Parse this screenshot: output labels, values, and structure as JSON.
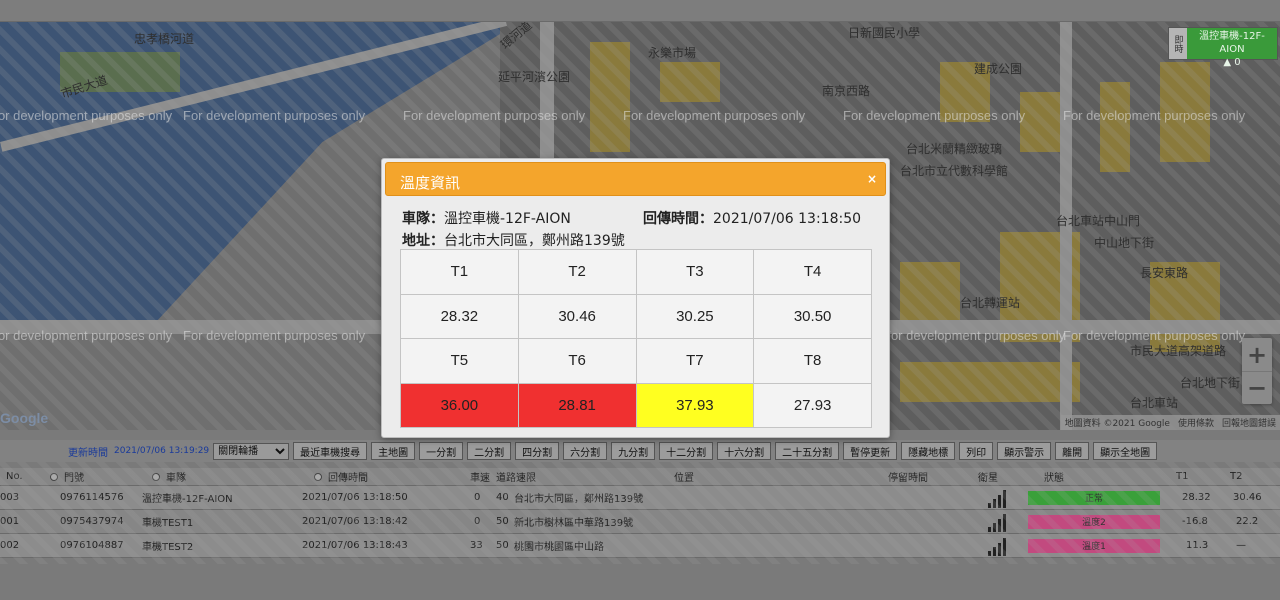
{
  "map": {
    "dev_watermark": "For development purposes only",
    "labels": [
      "忠孝橋河道",
      "市民大道",
      "環河道",
      "延平河濱公園",
      "永樂市場",
      "日新國民小學",
      "建成公園",
      "南京西路",
      "台北米蘭精緻玻璃",
      "台北市立代數科學館",
      "台北車站中山門",
      "中山地下街",
      "台北轉運站",
      "市民大道高架道路",
      "台北地下街",
      "台北車站",
      "長安東路"
    ],
    "attribution": [
      "地圖資料 ©2021 Google",
      "使用條款",
      "回報地圖錯誤"
    ],
    "zoom_in": "+",
    "zoom_out": "−",
    "vehicle_marker": {
      "side": "即時",
      "name": "溫控車機-12F-AION",
      "speed": "0"
    }
  },
  "toolbar": {
    "update_label": "更新時間",
    "update_time": "2021/07/06 13:19:29",
    "rotate_select": "關閉輪播",
    "buttons": [
      "最近車機搜尋",
      "主地圖",
      "一分割",
      "二分割",
      "四分割",
      "六分割",
      "九分割",
      "十二分割",
      "十六分割",
      "二十五分割",
      "暫停更新",
      "隱藏地標",
      "列印",
      "顯示警示",
      "離開",
      "顯示全地圖"
    ]
  },
  "table": {
    "headers": {
      "no": "No.",
      "door": "門號",
      "vehicle": "車隊",
      "time": "回傳時間",
      "speed": "車速",
      "limit": "道路速限",
      "location": "位置",
      "stay": "停留時間",
      "satellite": "衛星",
      "status": "狀態",
      "t1": "T1",
      "t2": "T2"
    },
    "rows": [
      {
        "no": "003",
        "door": "0976114576",
        "vehicle": "溫控車機-12F-AION",
        "time": "2021/07/06 13:18:50",
        "speed": "0",
        "limit": "40",
        "location": "台北市大同區，鄭州路139號",
        "status": "正常",
        "status_color": "#3aa03a",
        "t1": "28.32",
        "t2": "30.46"
      },
      {
        "no": "001",
        "door": "0975437974",
        "vehicle": "車機TEST1",
        "time": "2021/07/06 13:18:42",
        "speed": "0",
        "limit": "50",
        "location": "新北市樹林區中華路139號",
        "status": "溫度2",
        "status_color": "#c24a7f",
        "t1": "-16.8",
        "t2": "22.2"
      },
      {
        "no": "002",
        "door": "0976104887",
        "vehicle": "車機TEST2",
        "time": "2021/07/06 13:18:43",
        "speed": "33",
        "limit": "50",
        "location": "桃園市桃園區中山路",
        "status": "溫度1",
        "status_color": "#c24a7f",
        "t1": "11.3",
        "t2": "—"
      }
    ]
  },
  "modal": {
    "title": "溫度資訊",
    "close": "×",
    "fleet_label": "車隊：",
    "fleet_value": "溫控車機-12F-AION",
    "time_label": "回傳時間：",
    "time_value": "2021/07/06 13:18:50",
    "addr_label": "地址：",
    "addr_value": "台北市大同區，鄭州路139號",
    "sensors": [
      {
        "name": "T1",
        "value": "28.32",
        "color": "#f3f3f3"
      },
      {
        "name": "T2",
        "value": "30.46",
        "color": "#f3f3f3"
      },
      {
        "name": "T3",
        "value": "30.25",
        "color": "#f3f3f3"
      },
      {
        "name": "T4",
        "value": "30.50",
        "color": "#f3f3f3"
      },
      {
        "name": "T5",
        "value": "36.00",
        "color": "#f03030"
      },
      {
        "name": "T6",
        "value": "28.81",
        "color": "#f03030"
      },
      {
        "name": "T7",
        "value": "37.93",
        "color": "#ffff20"
      },
      {
        "name": "T8",
        "value": "27.93",
        "color": "#f3f3f3"
      }
    ]
  }
}
